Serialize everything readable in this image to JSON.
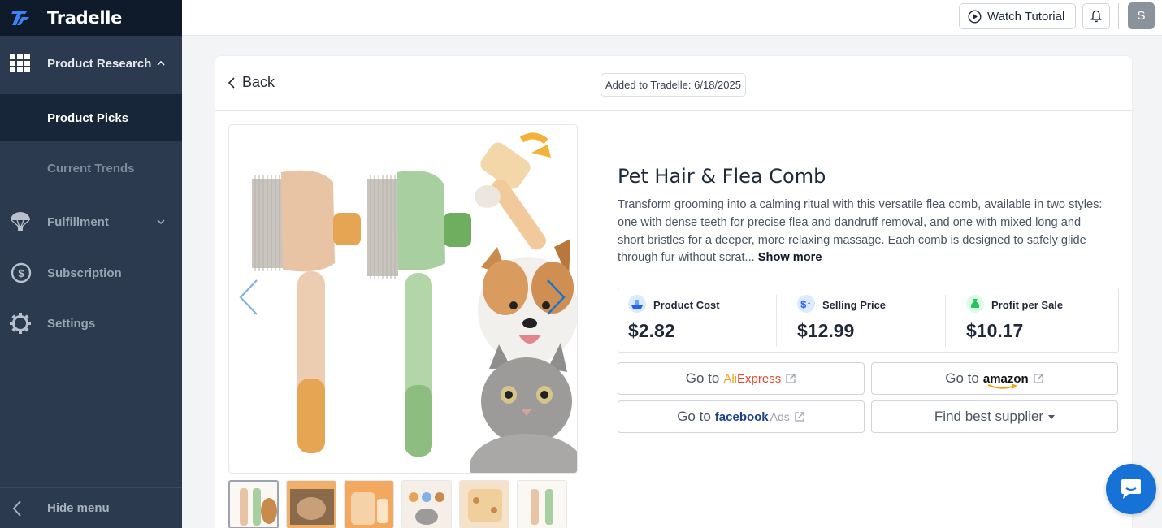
{
  "app": {
    "name": "Tradelle"
  },
  "sidebar": {
    "items": [
      {
        "label": "Product Research",
        "icon": "grid-icon"
      },
      {
        "label": "Product Picks"
      },
      {
        "label": "Current Trends"
      },
      {
        "label": "Fulfillment",
        "icon": "parachute-icon"
      },
      {
        "label": "Subscription",
        "icon": "dollar-circle-icon"
      },
      {
        "label": "Settings",
        "icon": "gear-icon"
      }
    ],
    "hide_menu": "Hide menu"
  },
  "topbar": {
    "watch_tutorial": "Watch Tutorial",
    "avatar_initial": "S"
  },
  "product": {
    "back_label": "Back",
    "added_date": "Added to Tradelle: 6/18/2025",
    "title": "Pet Hair & Flea Comb",
    "description": "Transform grooming into a calming ritual with this versatile flea comb, available in two styles: one with dense teeth for precise flea and dandruff removal, and one with mixed long and short bristles for a deeper, more relaxing massage. Each comb is designed to safely glide through fur without scrat...",
    "show_more": "Show more",
    "stats": [
      {
        "label": "Product Cost",
        "value": "$2.82"
      },
      {
        "label": "Selling Price",
        "value": "$12.99"
      },
      {
        "label": "Profit per Sale",
        "value": "$10.17"
      }
    ],
    "links": {
      "go_to": "Go to",
      "aliexpress_a": "Ali",
      "aliexpress_b": "Express",
      "amazon": "amazon",
      "facebook": "facebook",
      "facebook_ads": "Ads",
      "find_supplier": "Find best supplier"
    }
  },
  "colors": {
    "sidebar_bg": "#2b3a4f",
    "sidebar_active": "#18263a",
    "accent_blue": "#1672d6",
    "comb_beige": "#e8c4a4",
    "comb_green": "#9fc79a",
    "comb_orange": "#e6a552"
  }
}
